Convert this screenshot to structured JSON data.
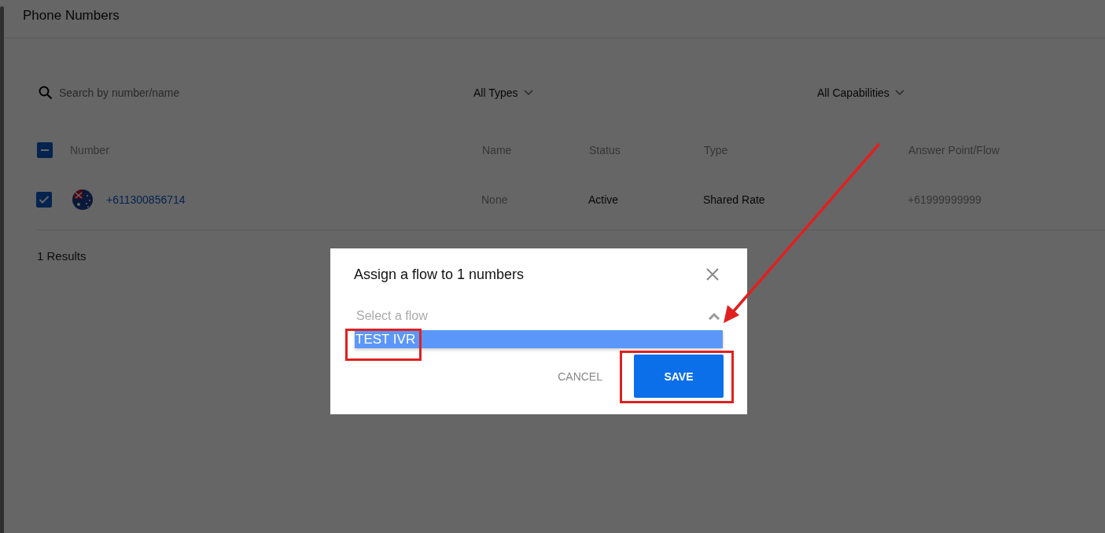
{
  "page": {
    "title": "Phone Numbers"
  },
  "filters": {
    "search": {
      "placeholder": "Search by number/name"
    },
    "type_filter": "All Types",
    "capability_filter": "All Capabilities"
  },
  "table": {
    "select_all": {
      "indeterminate": true
    },
    "columns": [
      "Number",
      "Name",
      "Status",
      "Type",
      "Answer Point/Flow"
    ],
    "rows": [
      {
        "checked": true,
        "number": "+611300856714",
        "name": "None",
        "status": "Active",
        "type": "Shared Rate",
        "answer_point": "+61999999999"
      }
    ]
  },
  "results": "1 Results",
  "dialog": {
    "title": "Assign a flow to 1 numbers",
    "select": {
      "placeholder": "Select a flow",
      "expanded": true
    },
    "options": [
      {
        "label": "TEST IVR",
        "selected": true
      }
    ],
    "buttons": [
      {
        "label": "CANCEL",
        "kind": "text"
      },
      {
        "label": "SAVE",
        "kind": "primary"
      }
    ]
  }
}
